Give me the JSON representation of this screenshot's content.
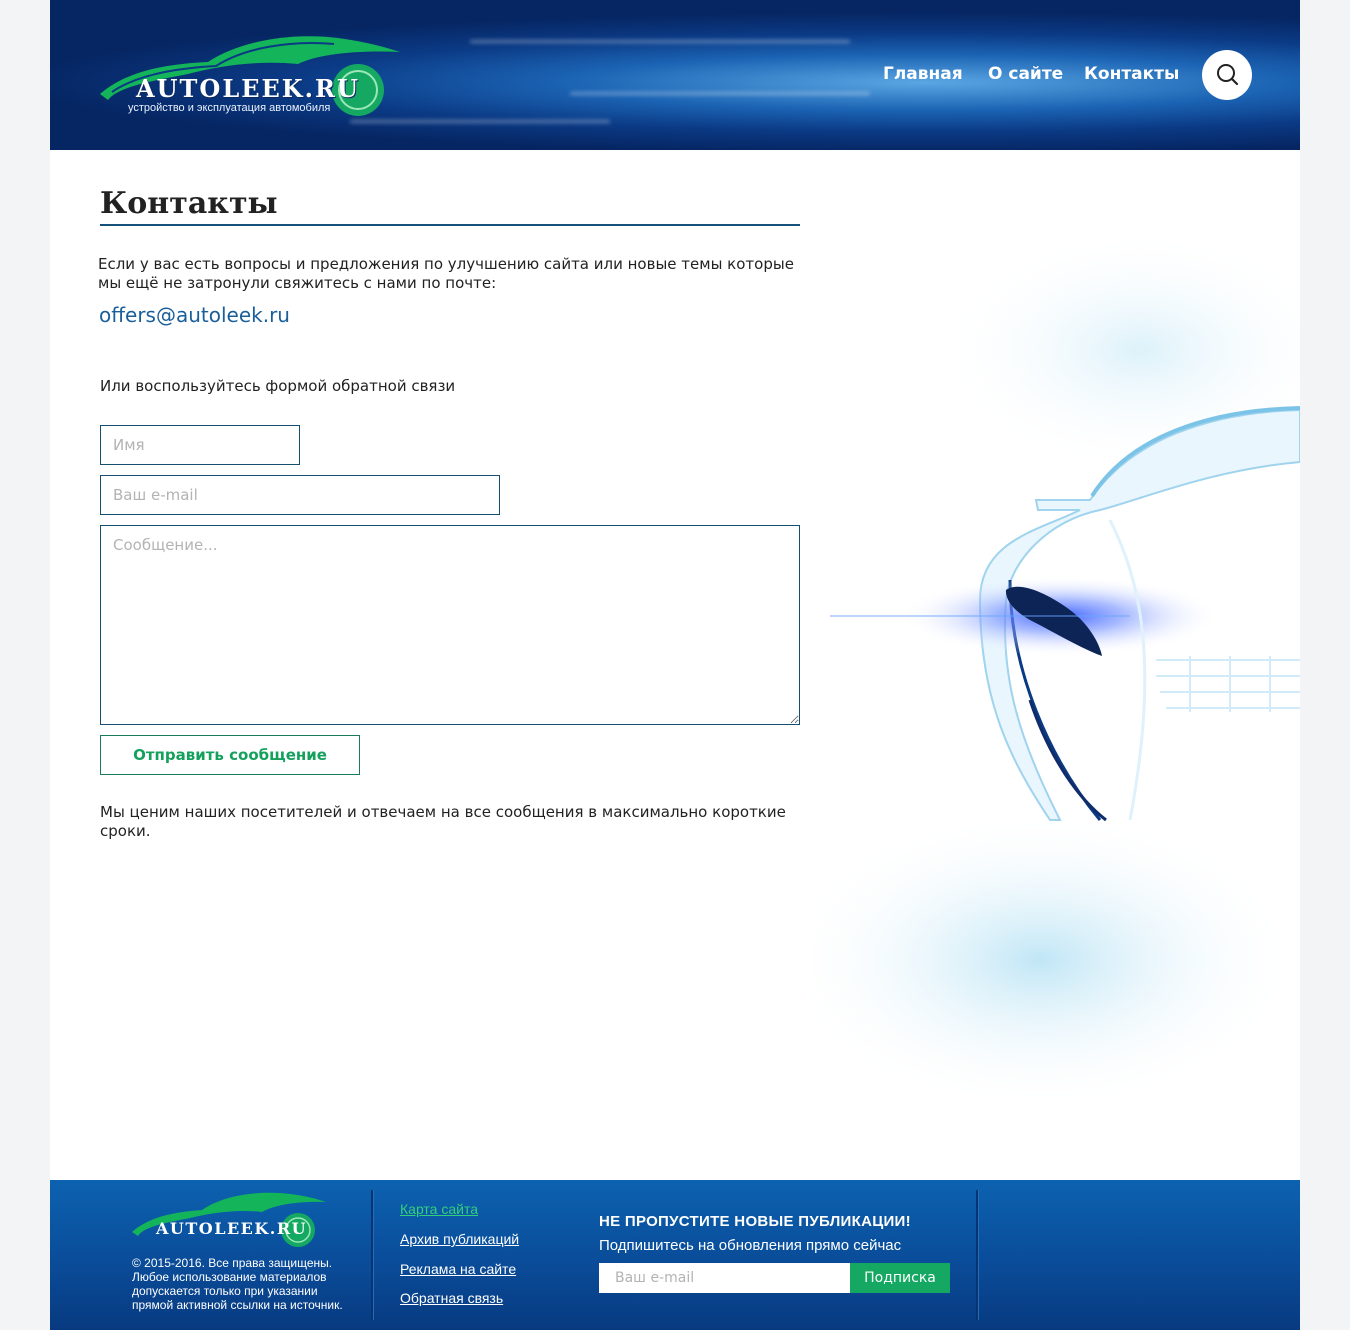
{
  "header": {
    "logo_text": "AUTOLEEK.RU",
    "logo_tagline": "устройство и эксплуатация автомобиля",
    "nav": [
      {
        "label": "Главная"
      },
      {
        "label": "О сайте"
      },
      {
        "label": "Контакты"
      }
    ],
    "search_icon": "search-icon"
  },
  "main": {
    "title": "Контакты",
    "intro": "Если у вас есть вопросы и предложения по улучшению сайта или новые темы которые мы ещё не затронули свяжитесь с нами по почте:",
    "email": "offers@autoleek.ru",
    "form_intro": "Или воспользуйтесь формой обратной связи",
    "form": {
      "name_placeholder": "Имя",
      "email_placeholder": "Ваш e-mail",
      "message_placeholder": "Сообщение...",
      "submit_label": "Отправить сообщение"
    },
    "outro": "Мы ценим наших посетителей и отвечаем на все сообщения в максимально короткие сроки."
  },
  "footer": {
    "logo_text": "AUTOLEEK.RU",
    "copyright": "© 2015-2016. Все права защищены. Любое использование материалов допускается только при указании прямой активной ссылки на источник.",
    "links": [
      {
        "label": "Карта сайта"
      },
      {
        "label": "Архив публикаций"
      },
      {
        "label": "Реклама на сайте"
      },
      {
        "label": "Обратная связь"
      }
    ],
    "subscribe": {
      "title": "НЕ ПРОПУСТИТЕ НОВЫЕ ПУБЛИКАЦИИ!",
      "text": "Подпишитесь на обновления прямо сейчас",
      "placeholder": "Ваш e-mail",
      "button_label": "Подписка"
    }
  },
  "colors": {
    "accent_green": "#14a862",
    "link_blue": "#1a5f9a",
    "header_blue": "#0b3a85"
  }
}
